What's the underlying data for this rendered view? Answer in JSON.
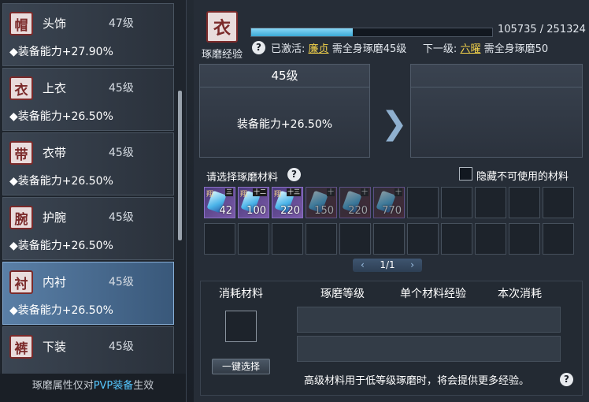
{
  "left": {
    "items": [
      {
        "name": "头饰",
        "level": "47级",
        "stat": "◆装备能力+27.90%",
        "icon": "hat-icon",
        "glyph": "帽"
      },
      {
        "name": "上衣",
        "level": "45级",
        "stat": "◆装备能力+26.50%",
        "icon": "robe-icon",
        "glyph": "衣"
      },
      {
        "name": "衣带",
        "level": "45级",
        "stat": "◆装备能力+26.50%",
        "icon": "belt-icon",
        "glyph": "带"
      },
      {
        "name": "护腕",
        "level": "45级",
        "stat": "◆装备能力+26.50%",
        "icon": "bracer-icon",
        "glyph": "腕"
      },
      {
        "name": "内衬",
        "level": "45级",
        "stat": "◆装备能力+26.50%",
        "icon": "lining-icon",
        "glyph": "衬"
      },
      {
        "name": "下装",
        "level": "45级",
        "stat": "",
        "icon": "pants-icon",
        "glyph": "裤"
      }
    ],
    "footer": {
      "prefix": "琢磨属性仅对",
      "highlight": "PVP装备",
      "suffix": "生效"
    }
  },
  "header": {
    "icon_label": "琢磨经验",
    "icon_glyph": "衣",
    "xp_text": "105735 / 251324",
    "progress_fraction": 0.42,
    "help": "?",
    "activated_label": "已激活:",
    "activated_name": "廉贞",
    "activated_desc": "需全身琢磨45级",
    "next_label": "下一级:",
    "next_name": "六曜",
    "next_desc": "需全身琢磨50"
  },
  "current_box": {
    "title": "45级",
    "stat": "装备能力+26.50%"
  },
  "arrow": "❯",
  "materials": {
    "title": "请选择琢磨材料",
    "help": "?",
    "hide_label": "隐藏不可使用的材料",
    "items": [
      {
        "tag": "翔",
        "grade": "三",
        "count": "42",
        "dim": false
      },
      {
        "tag": "翔",
        "grade": "十二",
        "count": "100",
        "dim": false
      },
      {
        "tag": "翔",
        "grade": "十三",
        "count": "220",
        "dim": false
      },
      {
        "tag": "",
        "grade": "十",
        "count": "150",
        "dim": true
      },
      {
        "tag": "",
        "grade": "十",
        "count": "220",
        "dim": true
      },
      {
        "tag": "",
        "grade": "十",
        "count": "770",
        "dim": true
      }
    ],
    "pager": "1/1",
    "prev": "‹",
    "next": "›"
  },
  "consume": {
    "col1": "消耗材料",
    "col2": "琢磨等级",
    "col3": "单个材料经验",
    "col4": "本次消耗",
    "button": "一键选择",
    "note": "高级材料用于低等级琢磨时，将会提供更多经验。",
    "help": "?"
  }
}
